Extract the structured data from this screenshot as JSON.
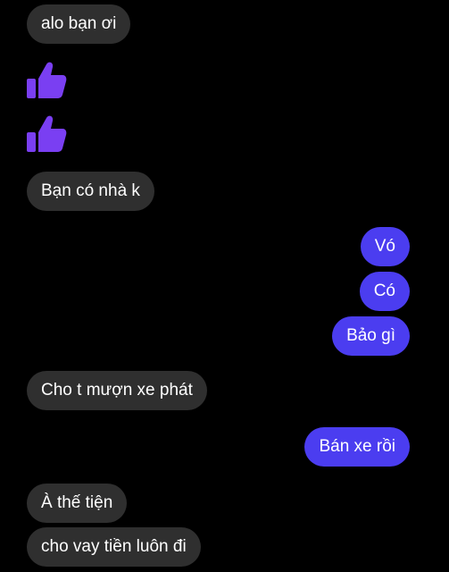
{
  "colors": {
    "background": "#000000",
    "incoming_bubble": "#2f2f2f",
    "outgoing_bubble": "#4b3df0",
    "thumb": "#7a3ff2"
  },
  "messages": [
    {
      "side": "incoming",
      "text": "alo bạn ơi"
    },
    {
      "side": "incoming",
      "type": "like",
      "icon": "thumbs-up-icon"
    },
    {
      "side": "incoming",
      "type": "like",
      "icon": "thumbs-up-icon"
    },
    {
      "side": "incoming",
      "text": "Bạn có nhà k"
    },
    {
      "side": "outgoing",
      "text": "Vó"
    },
    {
      "side": "outgoing",
      "text": "Có"
    },
    {
      "side": "outgoing",
      "text": "Bảo gì"
    },
    {
      "side": "incoming",
      "text": "Cho t mượn xe phát"
    },
    {
      "side": "outgoing",
      "text": "Bán xe rồi"
    },
    {
      "side": "incoming",
      "text": "À thế tiện"
    },
    {
      "side": "incoming",
      "text": "cho vay tiền luôn đi"
    }
  ]
}
